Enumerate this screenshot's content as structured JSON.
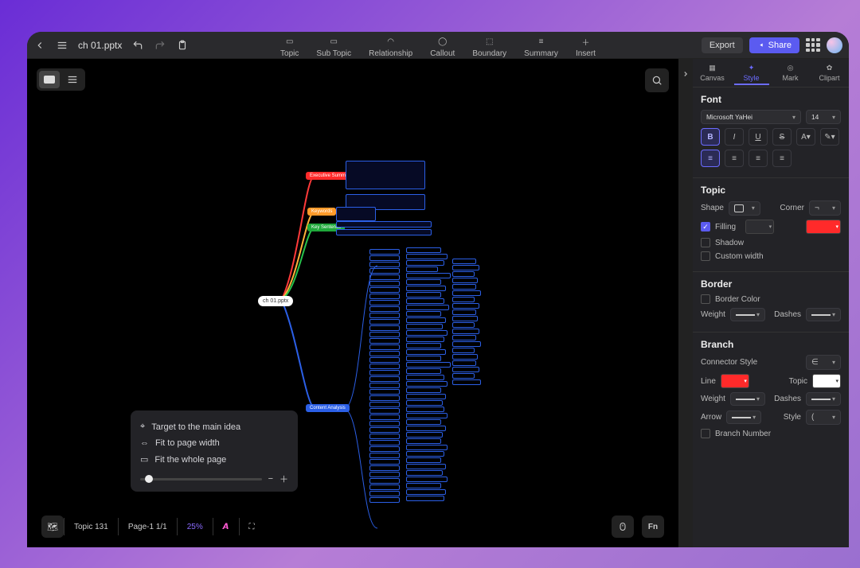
{
  "filename": "ch 01.pptx",
  "toolbar": {
    "topic": "Topic",
    "sub_topic": "Sub Topic",
    "relationship": "Relationship",
    "callout": "Callout",
    "boundary": "Boundary",
    "summary": "Summary",
    "insert": "Insert"
  },
  "actions": {
    "export": "Export",
    "share": "Share"
  },
  "zoom_menu": {
    "target": "Target to the main idea",
    "fit_width": "Fit to page width",
    "fit_page": "Fit the whole page"
  },
  "status_bar": {
    "topic_count": "Topic 131",
    "page": "Page-1  1/1",
    "zoom": "25%"
  },
  "panel": {
    "tabs": {
      "canvas": "Canvas",
      "style": "Style",
      "mark": "Mark",
      "clipart": "Clipart"
    },
    "font": {
      "title": "Font",
      "family": "Microsoft YaHei",
      "size": "14"
    },
    "topic": {
      "title": "Topic",
      "shape": "Shape",
      "corner": "Corner",
      "filling": "Filling",
      "shadow": "Shadow",
      "custom_width": "Custom width",
      "fill_color": "#ff2a2a"
    },
    "border": {
      "title": "Border",
      "border_color": "Border Color",
      "weight": "Weight",
      "dashes": "Dashes"
    },
    "branch": {
      "title": "Branch",
      "connector_style": "Connector Style",
      "line": "Line",
      "topic": "Topic",
      "weight": "Weight",
      "dashes": "Dashes",
      "arrow": "Arrow",
      "style": "Style",
      "branch_number": "Branch Number",
      "line_color": "#ff2a2a",
      "topic_color": "#ffffff"
    }
  },
  "mind_map": {
    "root": "ch 01.pptx",
    "labels": {
      "executive_summary": "Executive Summary",
      "keywords": "Keywords",
      "key_sentence": "Key Sentence",
      "content_analysis": "Content Analysis"
    }
  }
}
